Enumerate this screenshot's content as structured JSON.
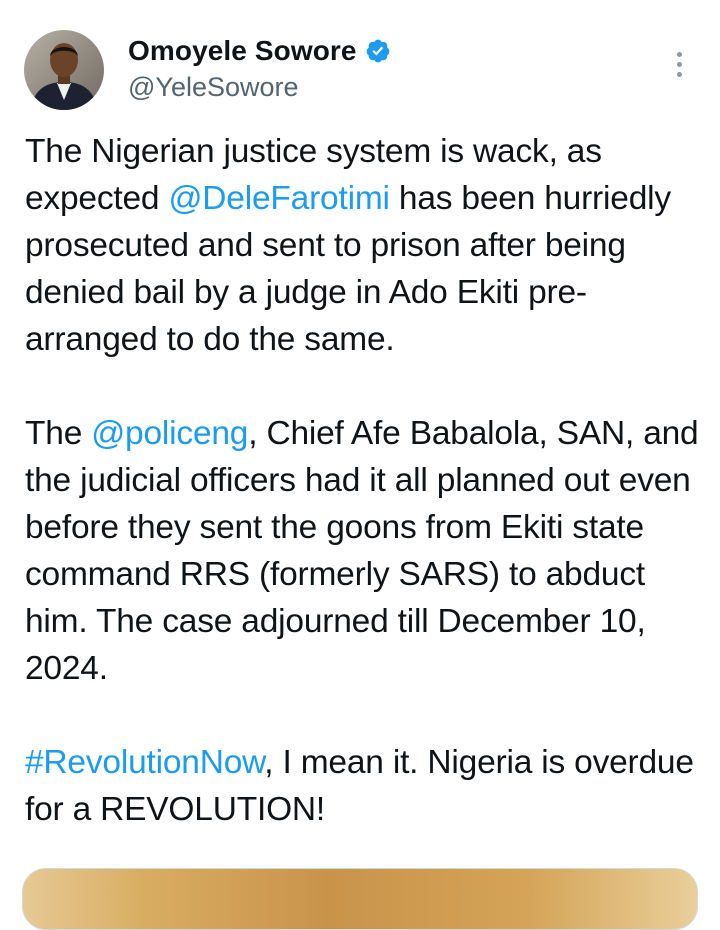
{
  "author": {
    "display_name": "Omoyele Sowore",
    "handle": "@YeleSowore",
    "verified": true
  },
  "tweet": {
    "p1": {
      "before": "The Nigerian justice system is wack, as expected ",
      "mention": "@DeleFarotimi",
      "after": " has been hurriedly prosecuted and sent to prison after being denied bail by a judge in Ado Ekiti pre-arranged to do the same."
    },
    "p2": {
      "before": "The ",
      "mention": "@policeng",
      "after": ", Chief Afe Babalola, SAN, and the judicial officers had it all planned out even before they sent the goons from Ekiti state command RRS (formerly SARS) to abduct him. The case adjourned till December 10, 2024."
    },
    "p3": {
      "hashtag": "#RevolutionNow",
      "after": ", I mean it. Nigeria is overdue for a REVOLUTION!"
    }
  },
  "colors": {
    "link": "#1d9bf0",
    "text": "#0f1419",
    "secondary": "#536471"
  },
  "icons": {
    "verified": "verified-badge-icon",
    "more": "more-options-icon"
  }
}
